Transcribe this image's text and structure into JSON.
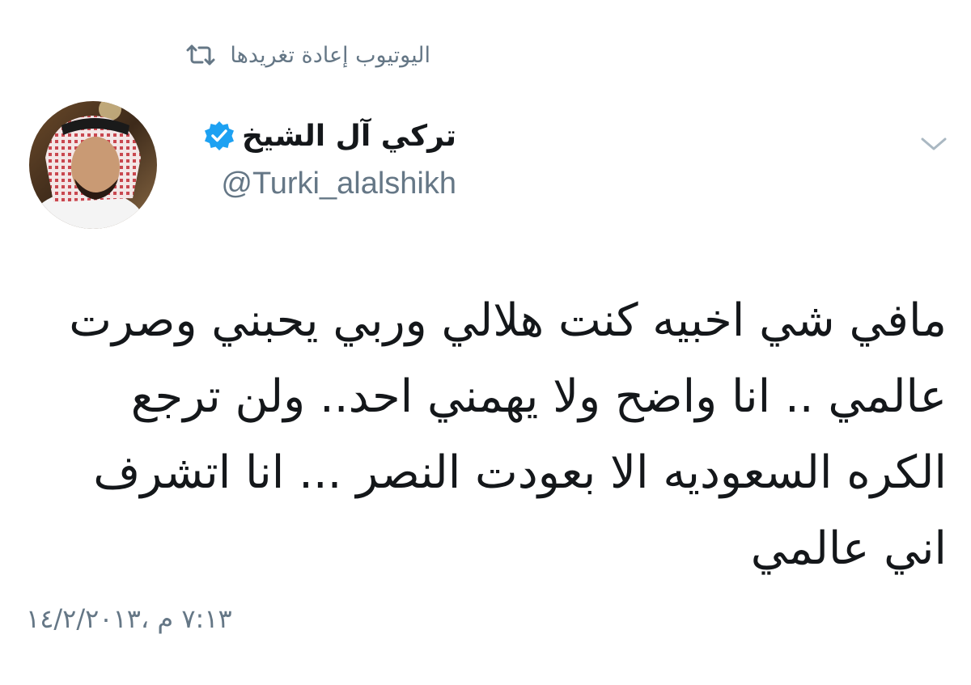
{
  "retweet": {
    "label": "اليوتيوب إعادة تغريدها",
    "icon": "retweet-icon"
  },
  "author": {
    "name": "تركي آل الشيخ",
    "handle": "@Turki_alalshikh",
    "verified": true,
    "verified_color": "#1da1f2"
  },
  "menu": {
    "icon": "chevron-down-icon"
  },
  "tweet": {
    "text": "مافي شي اخبيه كنت هلالي وربي يحبني وصرت عالمي .. انا واضح ولا يهمني احد.. ولن ترجع الكره السعوديه الا بعودت النصر ... انا اتشرف اني عالمي",
    "timestamp": "٧:١٣ م ،١٤/٢/٢٠١٣"
  },
  "colors": {
    "secondary_text": "#657786",
    "primary_text": "#14171a",
    "background": "#ffffff"
  }
}
